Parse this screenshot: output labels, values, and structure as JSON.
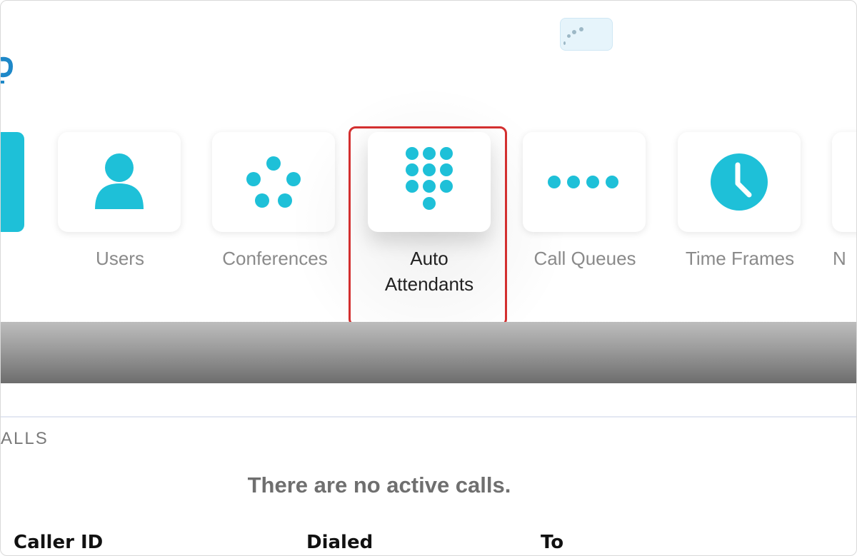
{
  "colors": {
    "accent": "#1ec0d8",
    "highlight_border": "#d32f2f",
    "label_inactive": "#8a8a8a",
    "label_active": "#222222",
    "bar_dark": "#6d6d6d"
  },
  "nav": {
    "tiles": [
      {
        "label": "Users",
        "icon": "user-icon"
      },
      {
        "label": "Conferences",
        "icon": "conference-dots-icon"
      },
      {
        "label": "Auto Attendants",
        "icon": "dialpad-icon",
        "line1": "Auto",
        "line2": "Attendants",
        "selected": true
      },
      {
        "label": "Call Queues",
        "icon": "queue-dots-icon"
      },
      {
        "label": "Time Frames",
        "icon": "clock-icon"
      }
    ],
    "partial_right_label": "N"
  },
  "active_calls": {
    "section_title": "ALLS",
    "empty_message": "There are no active calls.",
    "columns": [
      "Caller ID",
      "Dialed",
      "To"
    ]
  }
}
